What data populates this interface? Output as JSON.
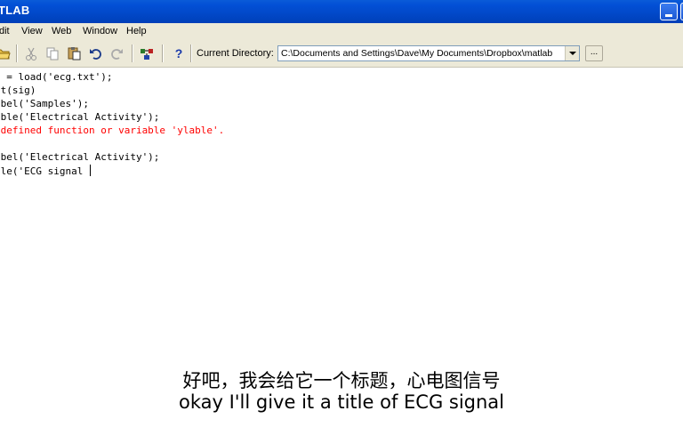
{
  "window": {
    "title": "TLAB"
  },
  "menu": {
    "items": [
      "dit",
      "View",
      "Web",
      "Window",
      "Help"
    ]
  },
  "toolbar": {
    "current_directory_label": "Current Directory:",
    "current_directory_value": "C:\\Documents and Settings\\Dave\\My Documents\\Dropbox\\matlab",
    "browse_label": "...",
    "help_label": "?"
  },
  "command_window": {
    "lines": [
      {
        "text": "g = load('ecg.txt');",
        "type": "normal"
      },
      {
        "text": "ot(sig)",
        "type": "normal"
      },
      {
        "text": "abel('Samples');",
        "type": "normal"
      },
      {
        "text": "able('Electrical Activity');",
        "type": "normal"
      },
      {
        "text": "ndefined function or variable 'ylable'.",
        "type": "error"
      },
      {
        "text": "",
        "type": "normal"
      },
      {
        "text": "abel('Electrical Activity');",
        "type": "normal"
      },
      {
        "text": "tle('ECG signal ",
        "type": "current"
      }
    ]
  },
  "subtitles": {
    "chinese": "好吧，我会给它一个标题，心电图信号",
    "english": "okay I'll give it a title of ECG signal"
  },
  "colors": {
    "titlebar": "#0350d6",
    "chrome": "#ece9d8",
    "error_text": "#ff0000"
  }
}
